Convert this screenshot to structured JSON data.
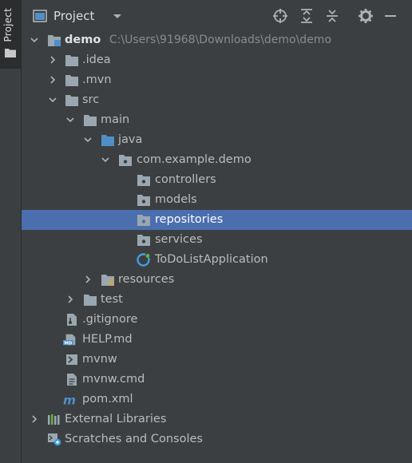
{
  "stripe": {
    "label": "Project"
  },
  "header": {
    "title": "Project"
  },
  "tree": [
    {
      "label": "demo",
      "path": "C:\\Users\\91968\\Downloads\\demo\\demo",
      "icon": "module-folder-icon",
      "expanded": true
    },
    {
      "label": ".idea",
      "icon": "folder-icon",
      "expanded": false
    },
    {
      "label": ".mvn",
      "icon": "folder-icon",
      "expanded": false
    },
    {
      "label": "src",
      "icon": "folder-icon",
      "expanded": true
    },
    {
      "label": "main",
      "icon": "folder-icon",
      "expanded": true
    },
    {
      "label": "java",
      "icon": "source-folder-icon",
      "expanded": true
    },
    {
      "label": "com.example.demo",
      "icon": "package-icon",
      "expanded": true
    },
    {
      "label": "controllers",
      "icon": "package-icon"
    },
    {
      "label": "models",
      "icon": "package-icon"
    },
    {
      "label": "repositories",
      "icon": "package-icon",
      "selected": true
    },
    {
      "label": "services",
      "icon": "package-icon"
    },
    {
      "label": "ToDoListApplication",
      "icon": "spring-boot-class-icon"
    },
    {
      "label": "resources",
      "icon": "resources-folder-icon",
      "expanded": false
    },
    {
      "label": "test",
      "icon": "folder-icon",
      "expanded": false
    },
    {
      "label": ".gitignore",
      "icon": "gitignore-file-icon"
    },
    {
      "label": "HELP.md",
      "icon": "markdown-file-icon"
    },
    {
      "label": "mvnw",
      "icon": "shell-script-icon"
    },
    {
      "label": "mvnw.cmd",
      "icon": "text-file-icon"
    },
    {
      "label": "pom.xml",
      "icon": "maven-icon"
    },
    {
      "label": "External Libraries",
      "icon": "libraries-icon",
      "expanded": false
    },
    {
      "label": "Scratches and Consoles",
      "icon": "scratches-icon"
    }
  ],
  "colors": {
    "selection": "#4b6eaf",
    "folder": "#9aa7b0",
    "source_folder": "#4f8fc8",
    "spring": "#3ea0e0"
  }
}
